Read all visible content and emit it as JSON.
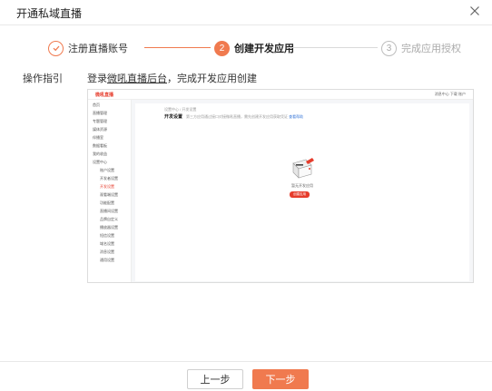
{
  "dialog": {
    "title": "开通私域直播",
    "close_icon": "close-icon"
  },
  "steps": [
    {
      "number": "1",
      "label": "注册直播账号",
      "status": "done"
    },
    {
      "number": "2",
      "label": "创建开发应用",
      "status": "active"
    },
    {
      "number": "3",
      "label": "完成应用授权",
      "status": "todo"
    }
  ],
  "guide": {
    "label": "操作指引",
    "text_before": "登录",
    "link_text": "微吼直播后台",
    "text_after": "，完成开发应用创建"
  },
  "preview": {
    "logo": "微吼直播",
    "topbar_right": "消息中心    下载    账户",
    "sidebar": [
      {
        "label": "首页",
        "level": "top"
      },
      {
        "label": "直播管理",
        "level": "top"
      },
      {
        "label": "专题管理",
        "level": "top"
      },
      {
        "label": "媒体资源",
        "level": "top"
      },
      {
        "label": "伴播室",
        "level": "top"
      },
      {
        "label": "数据看板",
        "level": "top"
      },
      {
        "label": "我的收益",
        "level": "top"
      },
      {
        "label": "设置中心",
        "level": "top"
      },
      {
        "label": "账户设置",
        "level": "sub"
      },
      {
        "label": "开发者设置",
        "level": "sub"
      },
      {
        "label": "开发设置",
        "level": "sub",
        "selected": true
      },
      {
        "label": "观看端设置",
        "level": "sub"
      },
      {
        "label": "功能配置",
        "level": "sub"
      },
      {
        "label": "直播间设置",
        "level": "sub"
      },
      {
        "label": "品牌自定义",
        "level": "sub"
      },
      {
        "label": "播放器设置",
        "level": "sub"
      },
      {
        "label": "短信设置",
        "level": "sub"
      },
      {
        "label": "域名设置",
        "level": "sub"
      },
      {
        "label": "消息设置",
        "level": "sub"
      },
      {
        "label": "通用设置",
        "level": "sub"
      }
    ],
    "breadcrumb": "设置中心  /  开发设置",
    "heading": "开发设置",
    "description": "第三方应用通过接口对接微吼直播，需先创建开发应用获取凭证",
    "description_link": "查看帮助",
    "empty_text": "暂无开发应用",
    "create_button": "创建应用"
  },
  "footer": {
    "prev_label": "上一步",
    "next_label": "下一步"
  },
  "colors": {
    "accent": "#f07a4f",
    "preview_brand": "#e63c2c"
  }
}
